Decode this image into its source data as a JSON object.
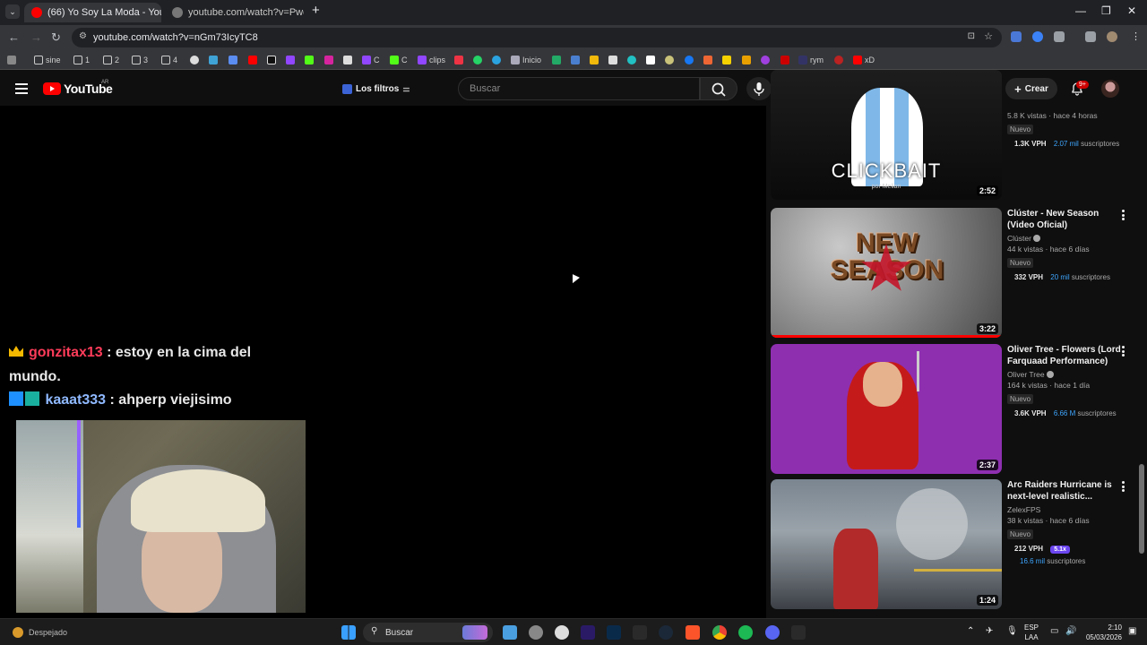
{
  "browser": {
    "tabs": [
      {
        "label": "(66) Yo Soy La Moda - YouTube",
        "active": true
      },
      {
        "label": "youtube.com/watch?v=Pwds04",
        "active": false
      }
    ],
    "new_tab": "+",
    "url": "youtube.com/watch?v=nGm73IcyTC8",
    "bookmarks": [
      "sine",
      "1",
      "2",
      "3",
      "4",
      "C",
      "C",
      "clips",
      "Inicio",
      "rym",
      "xD"
    ]
  },
  "youtube": {
    "country": "AR",
    "logo_text": "YouTube",
    "filters_label": "Los filtros",
    "search_placeholder": "Buscar",
    "create_label": "Crear",
    "notif_badge": "9+"
  },
  "chat": [
    {
      "user": "gonzitax13",
      "sep": " : ",
      "text": "estoy en la cima del mundo."
    },
    {
      "user": "kaaat333",
      "sep": " : ",
      "text": "ahperp viejisimo"
    }
  ],
  "recommendations": [
    {
      "thumb_text": "CLICKBAIT",
      "thumb_sub": "por Melian",
      "duration": "2:52",
      "title": "",
      "channel": "",
      "stats": "5.8 K vistas · hace 4 horas",
      "badge": "Nuevo",
      "vph": "1.3K VPH",
      "subs": "2.07 mil",
      "subs_label": "suscriptores"
    },
    {
      "thumb_text": "NEW SEASON",
      "duration": "3:22",
      "title": "Clúster - New Season (Video Oficial)",
      "channel": "Clúster",
      "stats": "44 k vistas · hace 6 días",
      "badge": "Nuevo",
      "vph": "332 VPH",
      "subs": "20 mil",
      "subs_label": "suscriptores",
      "progress": 1.0
    },
    {
      "duration": "2:37",
      "title": "Oliver Tree - Flowers (Lord Farquaad Performance)",
      "channel": "Oliver Tree",
      "stats": "164 k vistas · hace 1 día",
      "badge": "Nuevo",
      "vph": "3.6K VPH",
      "subs": "6.66 M",
      "subs_label": "suscriptores"
    },
    {
      "duration": "1:24",
      "title": "Arc Raiders Hurricane is next-level realistic...",
      "channel": "ZelexFPS",
      "stats": "38 k vistas · hace 6 días",
      "badge": "Nuevo",
      "vph": "212 VPH",
      "ratio": "5.1x",
      "subs": "16.6 mil",
      "subs_label": "suscriptores"
    }
  ],
  "taskbar": {
    "weather": "Despejado",
    "search_label": "Buscar",
    "lang": "ESP",
    "lang2": "LAA",
    "time": "2:10",
    "date": "05/03/2026"
  },
  "colors": {
    "yt_red": "#ff0000",
    "link_blue": "#3ea6ff",
    "chat_user1": "#ff3c5a",
    "chat_user2": "#8fb9ff"
  }
}
